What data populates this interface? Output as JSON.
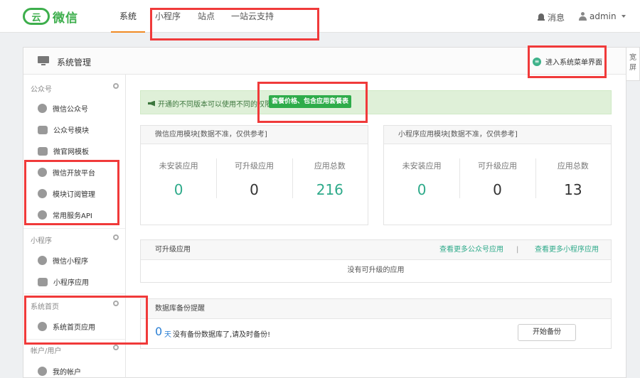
{
  "brand": {
    "mark": "云",
    "name": "微信"
  },
  "nav": {
    "items": [
      {
        "label": "系统",
        "active": true
      },
      {
        "label": "小程序"
      },
      {
        "label": "站点"
      },
      {
        "label": "一站云支持"
      }
    ],
    "messages": "消息",
    "user": "admin"
  },
  "panel": {
    "title": "系统管理",
    "enter_menu_icon": "≡",
    "enter_menu": "进入系统菜单界面",
    "wide_screen": "宽屏"
  },
  "sidebar": {
    "groups": [
      {
        "title": "公众号",
        "items": [
          "微信公众号",
          "公众号模块",
          "微官网模板",
          "微信开放平台",
          "模块订阅管理",
          "常用服务API"
        ]
      },
      {
        "title": "小程序",
        "items": [
          "微信小程序",
          "小程序应用"
        ]
      },
      {
        "title": "系统首页",
        "items": [
          "系统首页应用"
        ]
      },
      {
        "title": "帐户/用户",
        "items": [
          "我的帐户"
        ]
      }
    ]
  },
  "notice": {
    "text": "开通的不同版本可以使用不同的权限",
    "button": "套餐价格、包含应用套餐表"
  },
  "stats": {
    "wechat": {
      "title": "微信应用模块[数据不准，仅供参考]",
      "cols": [
        {
          "label": "未安装应用",
          "value": "0"
        },
        {
          "label": "可升级应用",
          "value": "0"
        },
        {
          "label": "应用总数",
          "value": "216"
        }
      ]
    },
    "mini": {
      "title": "小程序应用模块[数据不准，仅供参考]",
      "cols": [
        {
          "label": "未安装应用",
          "value": "0"
        },
        {
          "label": "可升级应用",
          "value": "0"
        },
        {
          "label": "应用总数",
          "value": "13"
        }
      ]
    }
  },
  "upgrade": {
    "title": "可升级应用",
    "link_wechat": "查看更多公众号应用",
    "separator": "|",
    "link_mini": "查看更多小程序应用",
    "empty": "没有可升级的应用"
  },
  "backup": {
    "title": "数据库备份提醒",
    "count": "0",
    "unit": "天",
    "message": "没有备份数据库了,请及时备份!",
    "button": "开始备份"
  },
  "colors": {
    "brand_green": "#3dae4c",
    "accent_orange": "#f08a24",
    "value_teal": "#2eaa8a",
    "highlight_red": "#f03a3a"
  }
}
